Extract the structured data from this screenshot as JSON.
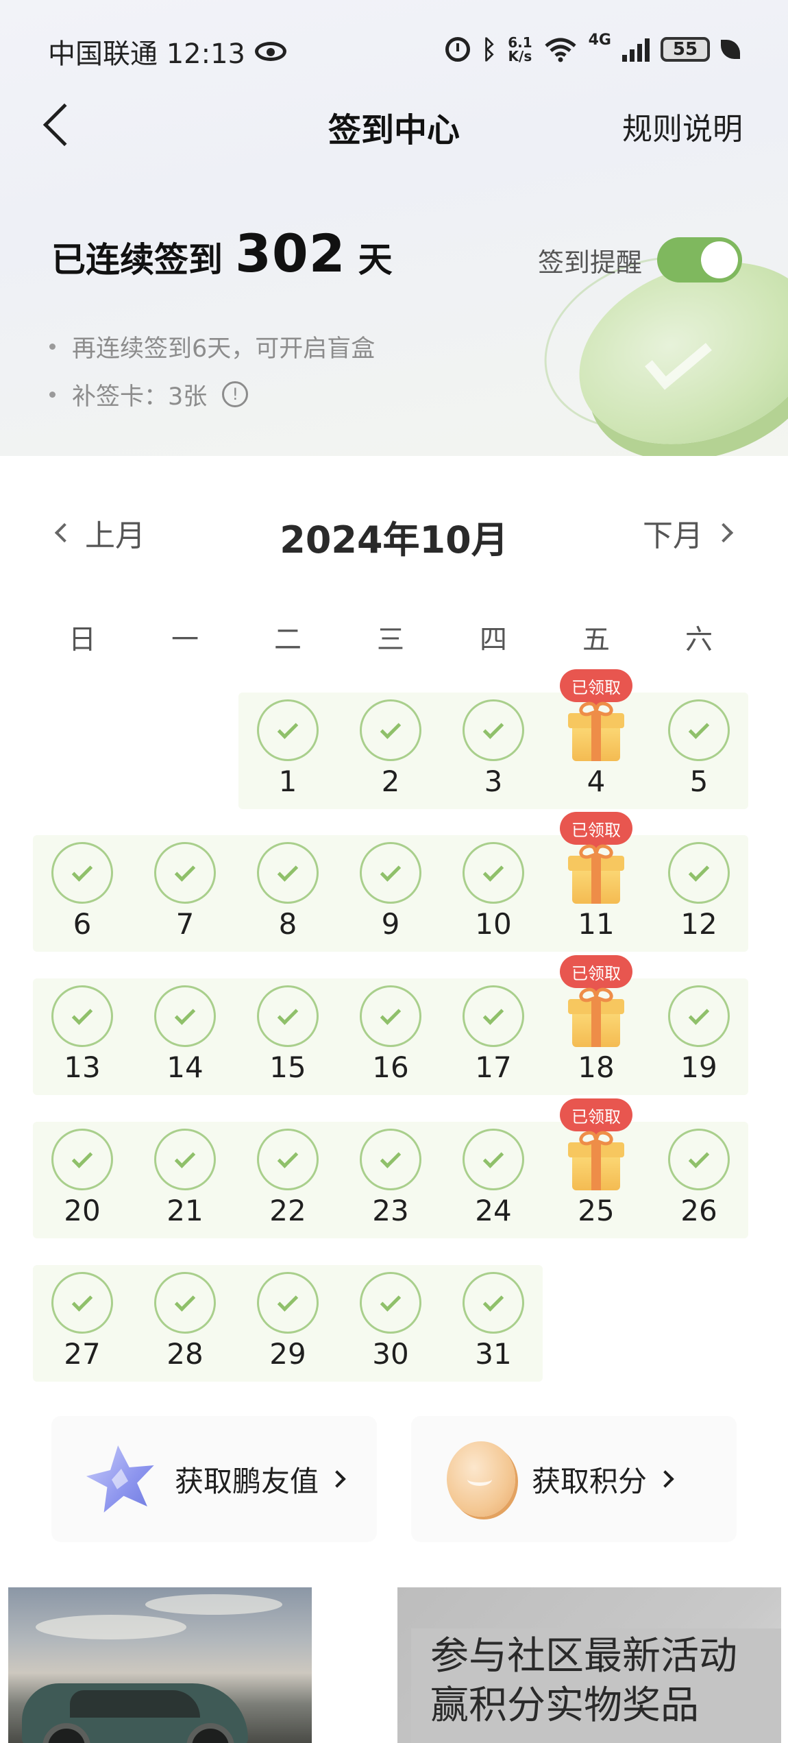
{
  "status_bar": {
    "carrier_time": "中国联通 12:13",
    "net_speed_top": "6.1",
    "net_speed_bottom": "K/s",
    "network": "4G",
    "wifi_label": "6",
    "battery": "55",
    "icons": [
      "eye-icon",
      "alarm-icon",
      "bluetooth-icon",
      "wifi-icon",
      "signal-icon",
      "battery-icon",
      "leaf-icon"
    ]
  },
  "nav": {
    "title": "签到中心",
    "rules_link": "规则说明"
  },
  "streak": {
    "prefix": "已连续签到",
    "days": "302",
    "suffix": "天",
    "reminder_label": "签到提醒",
    "reminder_on": true,
    "tips": [
      "再连续签到6天，可开启盲盒",
      "补签卡：3张"
    ],
    "info_glyph": "!"
  },
  "calendar": {
    "prev_label": "上月",
    "next_label": "下月",
    "month_title": "2024年10月",
    "weekdays": [
      "日",
      "一",
      "二",
      "三",
      "四",
      "五",
      "六"
    ],
    "claimed_badge": "已领取",
    "weeks": [
      [
        null,
        null,
        "1",
        "2",
        "3",
        "4",
        "5"
      ],
      [
        "6",
        "7",
        "8",
        "9",
        "10",
        "11",
        "12"
      ],
      [
        "13",
        "14",
        "15",
        "16",
        "17",
        "18",
        "19"
      ],
      [
        "20",
        "21",
        "22",
        "23",
        "24",
        "25",
        "26"
      ],
      [
        "27",
        "28",
        "29",
        "30",
        "31",
        null,
        null
      ]
    ],
    "gift_days": [
      "4",
      "11",
      "18",
      "25"
    ],
    "checked_color": "#8fc06a",
    "badge_color": "#e8564f"
  },
  "actions": {
    "friend_value": "获取鹏友值",
    "points": "获取积分"
  },
  "banners": {
    "right_line1": "参与社区最新活动",
    "right_line2": "赢积分实物奖品"
  }
}
